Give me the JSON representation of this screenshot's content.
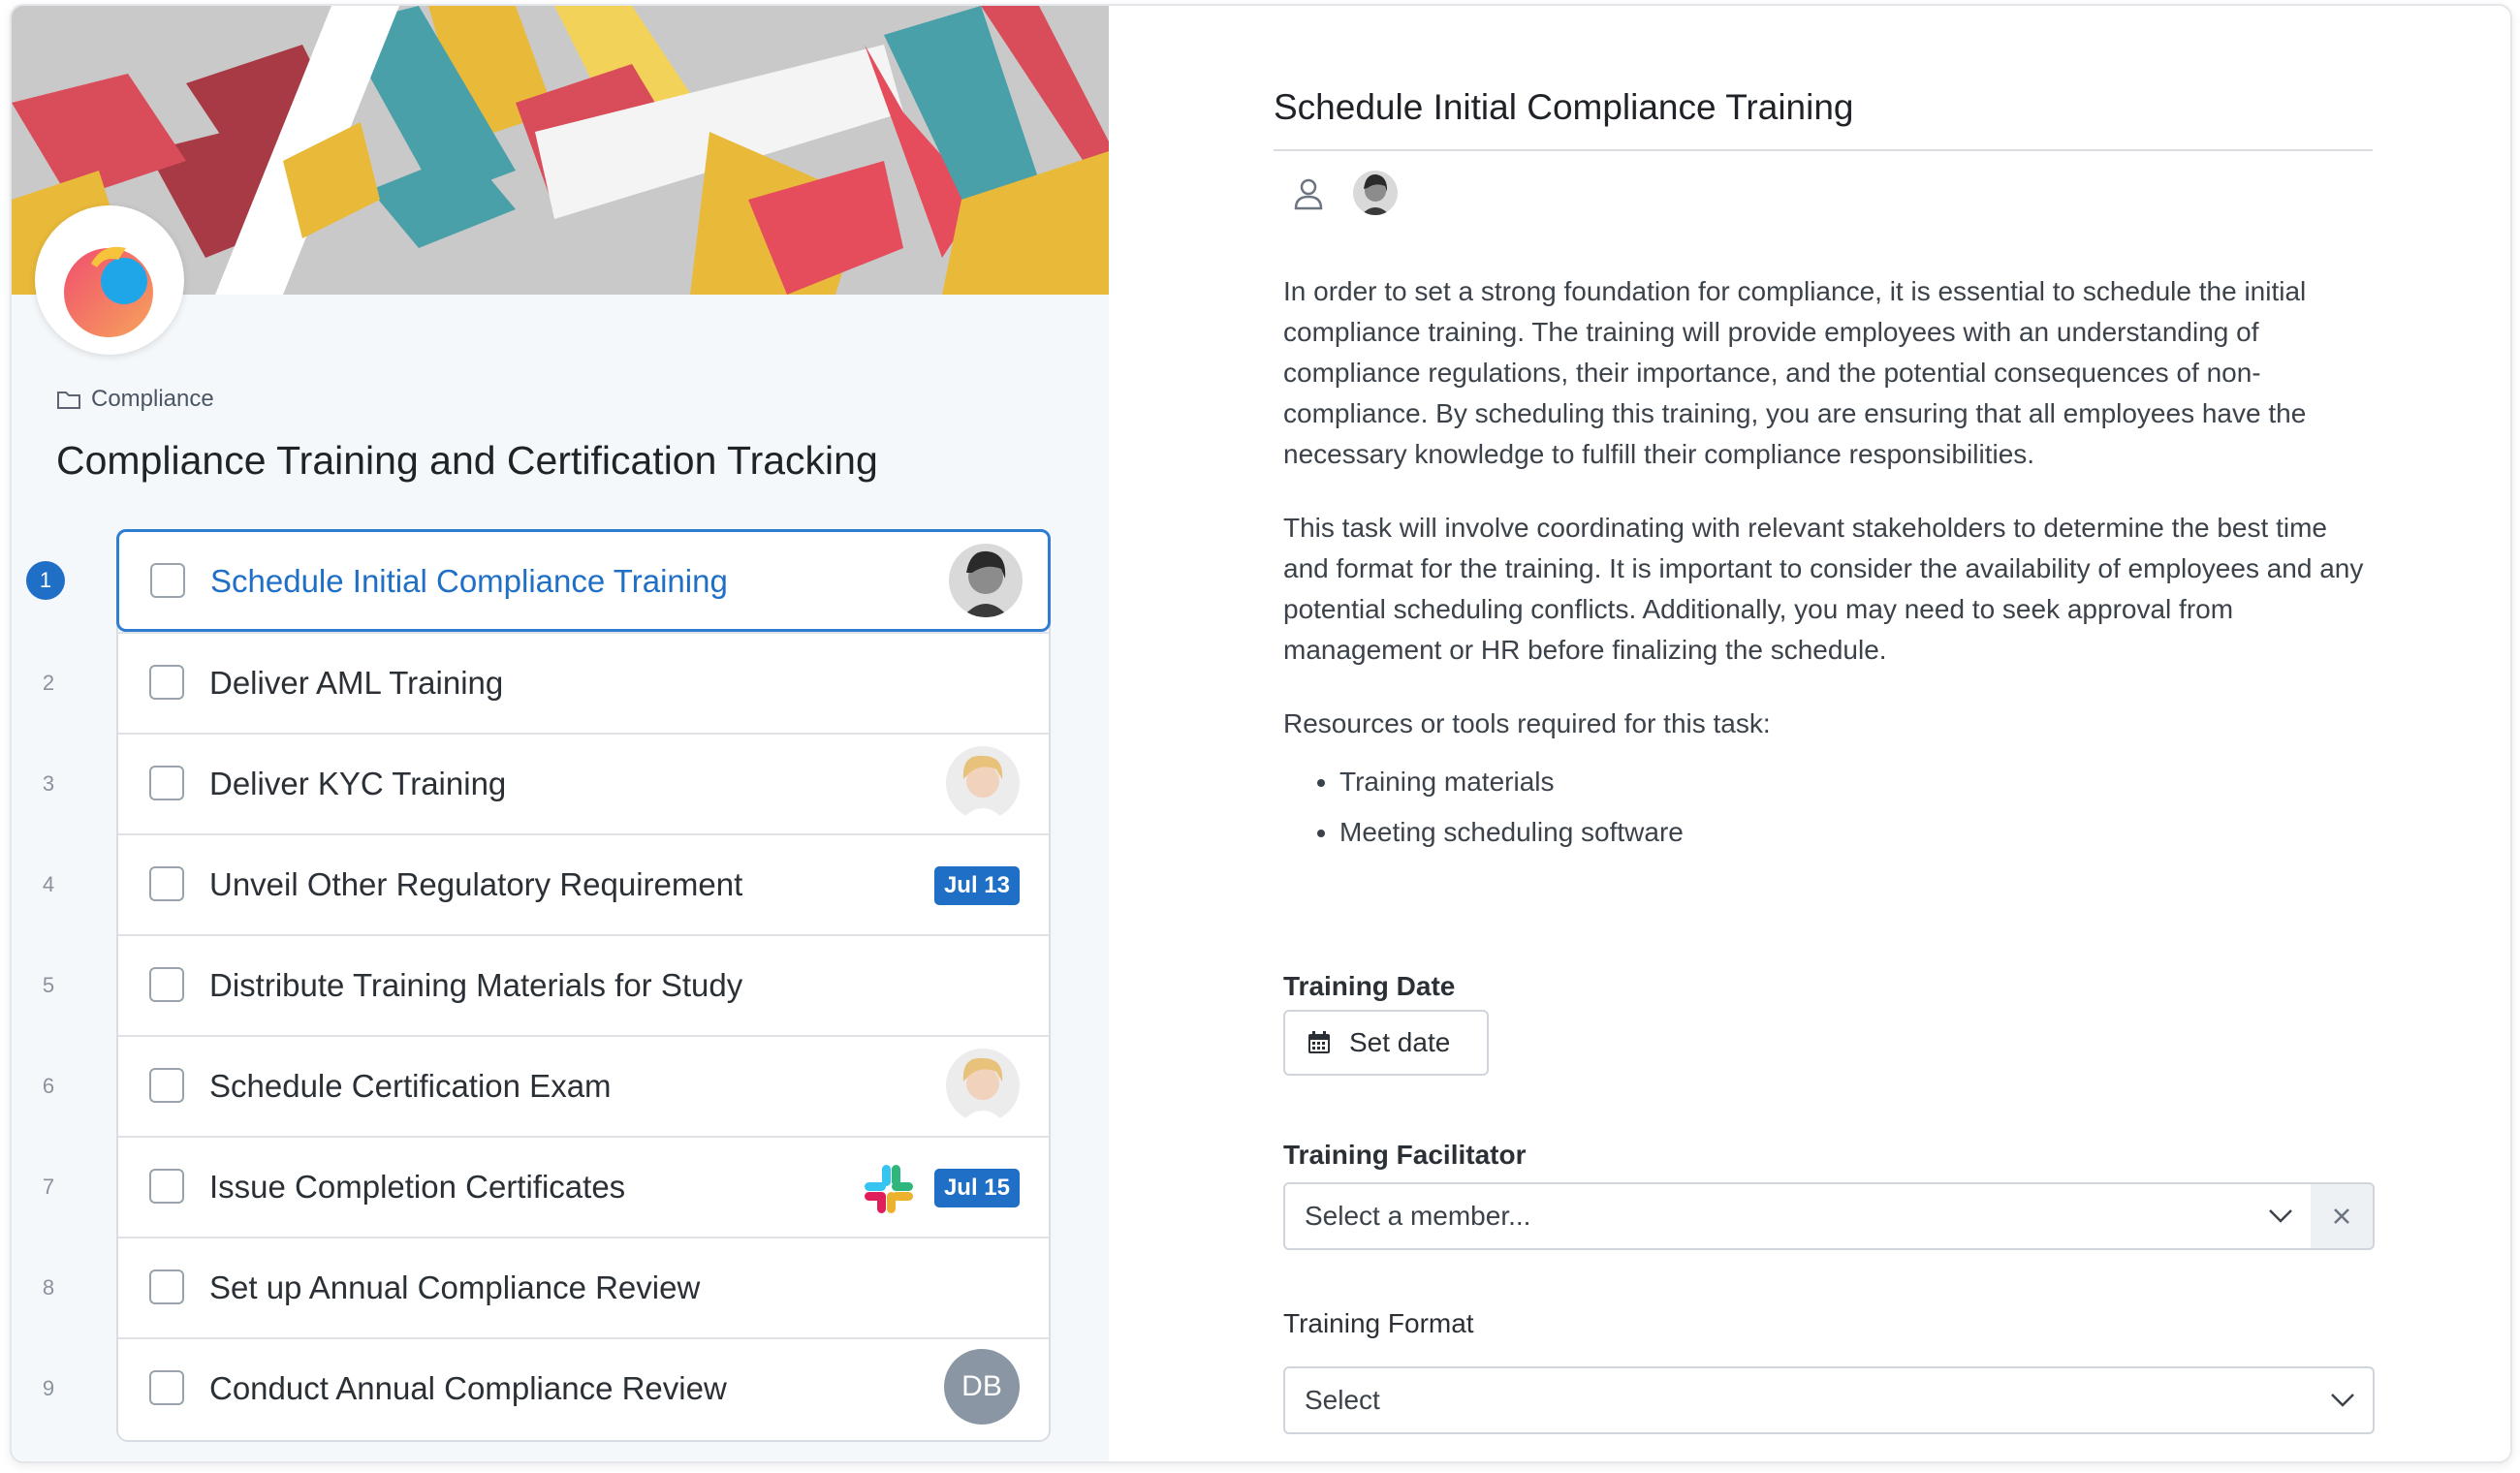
{
  "breadcrumb": {
    "label": "Compliance"
  },
  "workflow": {
    "title": "Compliance Training and Certification Tracking"
  },
  "tasks": [
    {
      "number": "1",
      "label": "Schedule Initial Compliance Training",
      "active": true,
      "assignee": "avatar"
    },
    {
      "number": "2",
      "label": "Deliver AML Training"
    },
    {
      "number": "3",
      "label": "Deliver KYC Training",
      "assignee": "avatar"
    },
    {
      "number": "4",
      "label": "Unveil Other Regulatory Requirement",
      "due": "Jul 13"
    },
    {
      "number": "5",
      "label": "Distribute Training Materials for Study"
    },
    {
      "number": "6",
      "label": "Schedule Certification Exam",
      "assignee": "avatar"
    },
    {
      "number": "7",
      "label": "Issue Completion Certificates",
      "integration": "slack-icon",
      "due": "Jul 15"
    },
    {
      "number": "8",
      "label": "Set up Annual Compliance Review"
    },
    {
      "number": "9",
      "label": "Conduct Annual Compliance Review",
      "assignee_initials": "DB"
    }
  ],
  "detail": {
    "title": "Schedule Initial Compliance Training",
    "paragraphs": [
      "In order to set a strong foundation for compliance, it is essential to schedule the initial compliance training. The training will provide employees with an understanding of compliance regulations, their importance, and the potential consequences of non-compliance. By scheduling this training, you are ensuring that all employees have the necessary knowledge to fulfill their compliance responsibilities.",
      "This task will involve coordinating with relevant stakeholders to determine the best time and format for the training. It is important to consider the availability of employees and any potential scheduling conflicts. Additionally, you may need to seek approval from management or HR before finalizing the schedule.",
      "Resources or tools required for this task:"
    ],
    "resources": [
      "Training materials",
      "Meeting scheduling software"
    ],
    "training_date": {
      "label": "Training Date",
      "button": "Set date"
    },
    "training_facilitator": {
      "label": "Training Facilitator",
      "placeholder": "Select a member..."
    },
    "training_format": {
      "label": "Training Format",
      "value": "Select"
    }
  },
  "colors": {
    "accent": "#1f6fc6",
    "badge": "#1f6fc6",
    "left_bg": "#f5f8fb"
  }
}
